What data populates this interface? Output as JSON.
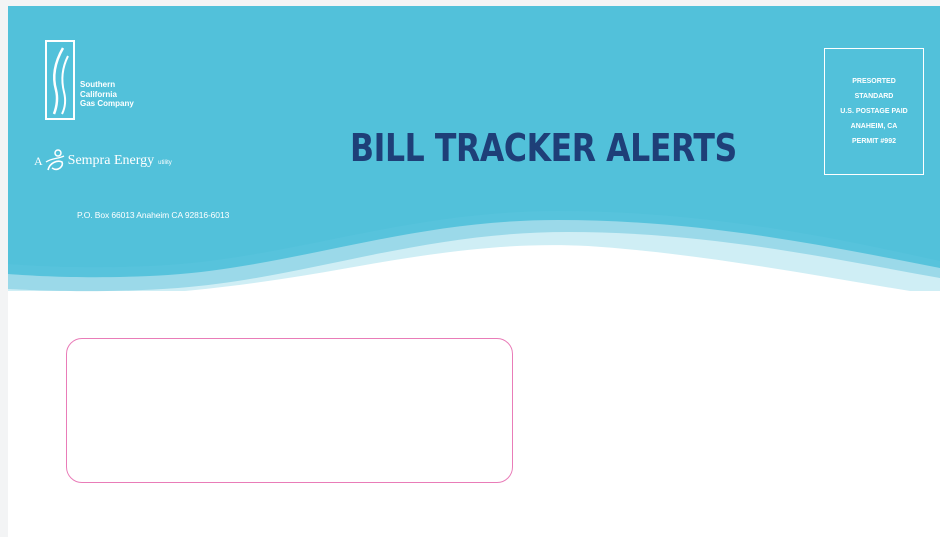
{
  "sender": {
    "company_lines": [
      "Southern",
      "California",
      "Gas Company"
    ],
    "affiliation": {
      "prefix": "A",
      "brand": "Sempra Energy",
      "suffix": "utility"
    },
    "address": "P.O. Box 66013  Anaheim CA 92816-6013"
  },
  "title": "BILL TRACKER ALERTS",
  "postage_indicia": [
    "PRESORTED",
    "STANDARD",
    "U.S. POSTAGE PAID",
    "ANAHEIM, CA",
    "PERMIT #992"
  ],
  "colors": {
    "banner": "#57c3dc",
    "title": "#1e3f78",
    "window_border": "#e97cb8"
  }
}
